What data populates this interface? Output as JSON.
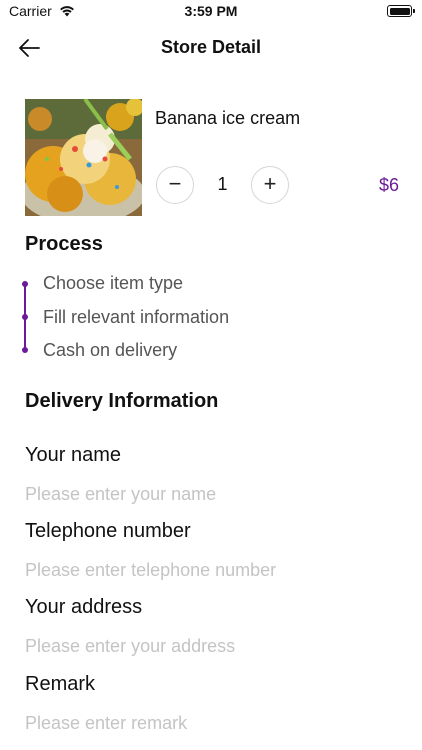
{
  "status_bar": {
    "carrier": "Carrier",
    "time": "3:59 PM"
  },
  "nav": {
    "title": "Store Detail",
    "back_icon": "arrow-left-icon"
  },
  "product": {
    "name": "Banana ice cream",
    "quantity": "1",
    "price": "$6",
    "minus_label": "−",
    "plus_label": "+"
  },
  "process": {
    "title": "Process",
    "steps": [
      "Choose item type",
      "Fill relevant information",
      "Cash on delivery"
    ]
  },
  "delivery": {
    "title": "Delivery Information",
    "fields": [
      {
        "label": "Your name",
        "placeholder": "Please enter your name"
      },
      {
        "label": "Telephone number",
        "placeholder": "Please enter telephone number"
      },
      {
        "label": "Your address",
        "placeholder": "Please enter your address"
      },
      {
        "label": "Remark",
        "placeholder": "Please enter remark"
      }
    ]
  },
  "colors": {
    "accent": "#6a1b9a",
    "placeholder": "#c4c4c4"
  }
}
